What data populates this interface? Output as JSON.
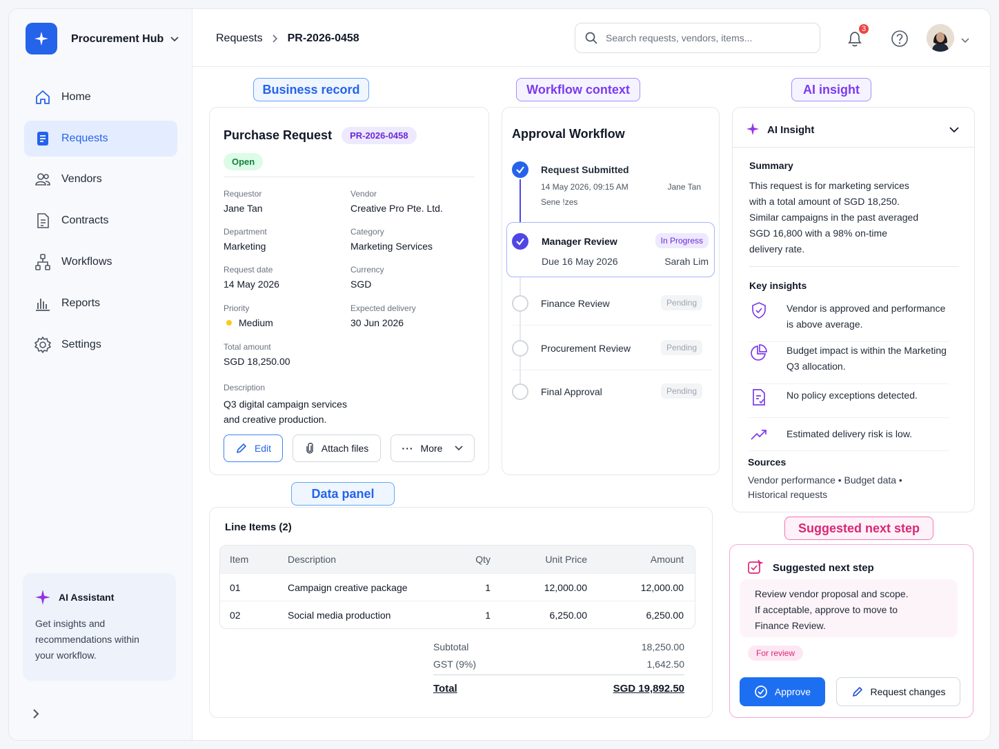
{
  "app": {
    "brand": "Procurement Hub"
  },
  "nav": [
    {
      "label": "Home",
      "icon": "home-icon"
    },
    {
      "label": "Requests",
      "icon": "document-icon"
    },
    {
      "label": "Vendors",
      "icon": "users-icon"
    },
    {
      "label": "Contracts",
      "icon": "contract-icon"
    },
    {
      "label": "Workflows",
      "icon": "workflow-icon"
    },
    {
      "label": "Reports",
      "icon": "bar-chart-icon"
    },
    {
      "label": "Settings",
      "icon": "gear-icon"
    }
  ],
  "assistant": {
    "title": "AI Assistant",
    "text": "Get insights and recommendations within your workflow."
  },
  "breadcrumb": {
    "parent": "Requests",
    "current": "PR-2026-0458"
  },
  "search": {
    "placeholder": "Search requests, vendors, items..."
  },
  "notifications": {
    "count": "3"
  },
  "tags": {
    "business": "Business record",
    "workflow": "Workflow context",
    "insight": "AI insight",
    "data": "Data panel",
    "next": "Suggested next step"
  },
  "request": {
    "title": "Purchase Request",
    "id": "PR-2026-0458",
    "status": "Open",
    "requestor_label": "Requestor",
    "requestor": "Jane Tan",
    "vendor_label": "Vendor",
    "vendor": "Creative Pro Pte. Ltd.",
    "department_label": "Department",
    "department": "Marketing",
    "category_label": "Category",
    "category": "Marketing Services",
    "date_label": "Request date",
    "date": "14 May 2026",
    "currency_label": "Currency",
    "currency": "SGD",
    "priority_label": "Priority",
    "priority": "Medium",
    "delivery_label": "Expected delivery",
    "delivery": "30 Jun 2026",
    "total_label": "Total amount",
    "total": "SGD 18,250.00",
    "desc_label": "Description",
    "desc1": "Q3 digital campaign services",
    "desc2": "and creative production.",
    "edit": "Edit",
    "attach": "Attach files",
    "more": "More",
    "priority_color": "#facc15"
  },
  "workflow": {
    "title": "Approval Workflow",
    "steps": [
      {
        "name": "Request Submitted",
        "meta": "14 May 2026, 09:15 AM",
        "person": "Jane Tan",
        "note": "Sene !zes"
      },
      {
        "name": "Manager Review",
        "meta": "Due 16 May 2026",
        "person": "Sarah Lim",
        "status": "In Progress"
      },
      {
        "name": "Finance Review",
        "status": "Pending"
      },
      {
        "name": "Procurement Review",
        "status": "Pending"
      },
      {
        "name": "Final Approval",
        "status": "Pending"
      }
    ]
  },
  "insight": {
    "title": "AI Insight",
    "summary_label": "Summary",
    "summary": [
      "This request is for marketing services",
      "with a total amount of SGD 18,250.",
      "Similar campaigns in the past averaged",
      "SGD 16,800 with a 98% on-time",
      "delivery rate."
    ],
    "key_label": "Key insights",
    "items": [
      {
        "icon": "shield-check-icon",
        "text": "Vendor is approved and performance is above average."
      },
      {
        "icon": "pie-chart-icon",
        "text": "Budget impact is within the Marketing Q3 allocation."
      },
      {
        "icon": "document-check-icon",
        "text": "No policy exceptions detected."
      },
      {
        "icon": "trend-up-icon",
        "text": "Estimated delivery risk is low."
      }
    ],
    "sources_label": "Sources",
    "sources1": "Vendor performance • Budget data •",
    "sources2": "Historical requests"
  },
  "lineitems": {
    "title": "Line Items (2)",
    "headers": [
      "Item",
      "Description",
      "Qty",
      "Unit Price",
      "Amount"
    ],
    "rows": [
      [
        "01",
        "Campaign creative package",
        "1",
        "12,000.00",
        "12,000.00"
      ],
      [
        "02",
        "Social media production",
        "1",
        "6,250.00",
        "6,250.00"
      ]
    ],
    "subtotal_label": "Subtotal",
    "subtotal": "18,250.00",
    "gst_label": "GST (9%)",
    "gst": "1,642.50",
    "total_label": "Total",
    "total": "SGD 19,892.50"
  },
  "next": {
    "title": "Suggested next step",
    "text1": "Review vendor proposal and scope.",
    "text2": "If acceptable, approve to move to",
    "text3": "Finance Review.",
    "badge": "For review",
    "approve": "Approve",
    "changes": "Request changes"
  }
}
